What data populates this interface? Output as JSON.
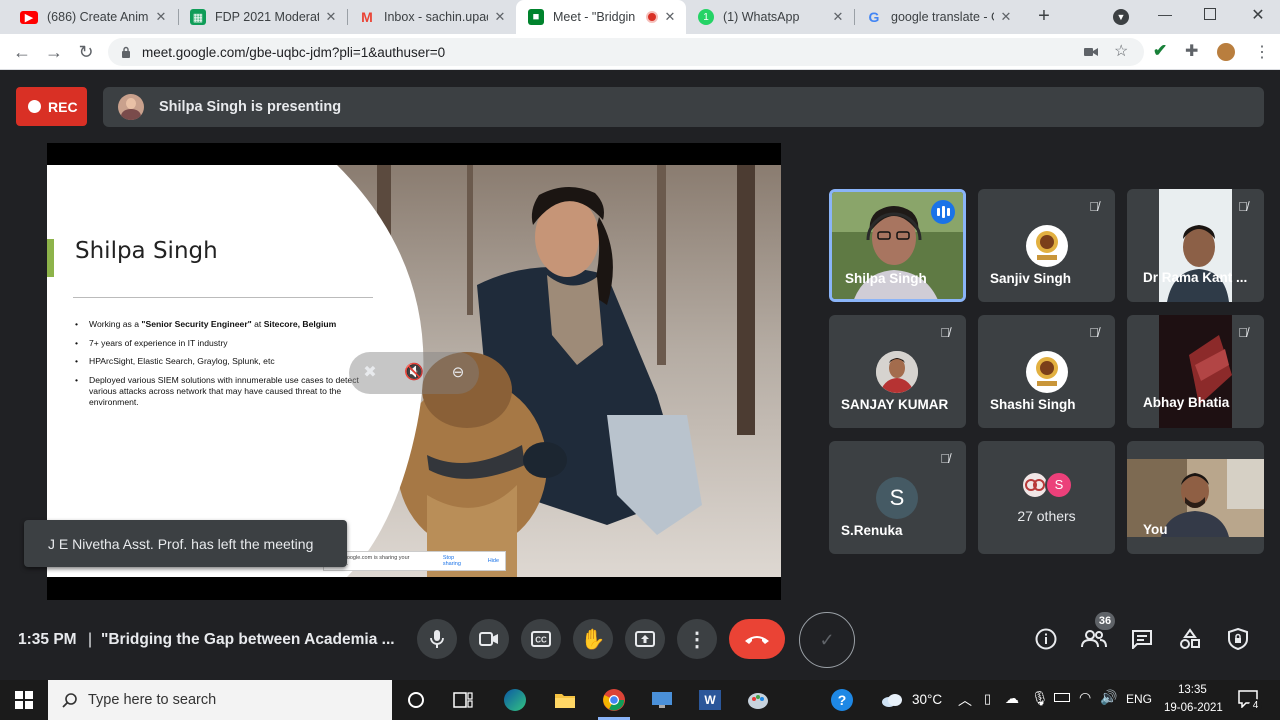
{
  "browser": {
    "tabs": [
      {
        "title": "(686) Create Animat",
        "icon": "youtube-icon",
        "color": "#ff0000",
        "active": false
      },
      {
        "title": "FDP 2021 Moderato",
        "icon": "sheets-icon",
        "color": "#0f9d58",
        "active": false
      },
      {
        "title": "Inbox - sachin.upad",
        "icon": "gmail-icon",
        "color": "#ea4335",
        "active": false
      },
      {
        "title": "Meet - \"Bridgin",
        "icon": "meet-icon",
        "color": "#00832d",
        "active": true
      },
      {
        "title": "(1) WhatsApp",
        "icon": "whatsapp-icon",
        "color": "#25d366",
        "active": false
      },
      {
        "title": "google translate - G",
        "icon": "google-icon",
        "color": "#4285f4",
        "active": false
      }
    ],
    "url": "meet.google.com/gbe-uqbc-jdm?pli=1&authuser=0"
  },
  "meet": {
    "rec_label": "REC",
    "presenting_text": "Shilpa Singh is presenting",
    "slide": {
      "name": "Shilpa Singh",
      "bullets": [
        {
          "pre": "Working as a ",
          "bold1": "\"Senior Security Engineer\"",
          "mid": " at ",
          "bold2": "Sitecore, Belgium"
        },
        {
          "pre": "7+ years of experience in IT industry"
        },
        {
          "pre": "HPArcSight, Elastic Search, Graylog, Splunk, etc"
        },
        {
          "pre": "Deployed various SIEM solutions with innumerable use cases to detect various attacks across network that may have caused threat to the environment."
        }
      ],
      "share_notice": "meet.google.com is sharing your screen.",
      "stop_sharing": "Stop sharing",
      "hide": "Hide"
    },
    "toast": "J E Nivetha Asst. Prof. has left the meeting",
    "participants": [
      {
        "name": "Shilpa Singh",
        "kind": "video"
      },
      {
        "name": "Sanjiv Singh",
        "kind": "avatar"
      },
      {
        "name": "Dr Rama Kant ...",
        "kind": "video"
      },
      {
        "name": "SANJAY KUMAR",
        "kind": "avatar"
      },
      {
        "name": "Shashi Singh",
        "kind": "avatar"
      },
      {
        "name": "Abhay Bhatia",
        "kind": "video"
      },
      {
        "name": "S.Renuka",
        "kind": "letter",
        "letter": "S"
      },
      {
        "name": "27 others",
        "kind": "others",
        "letter": "S"
      },
      {
        "name": "You",
        "kind": "video"
      }
    ],
    "time": "1:35 PM",
    "separator": "|",
    "meeting_title": "\"Bridging the Gap between Academia ...",
    "participant_count": "36"
  },
  "taskbar": {
    "search_placeholder": "Type here to search",
    "temperature": "30°C",
    "language": "ENG",
    "time": "13:35",
    "date": "19-06-2021",
    "notification_count": "4"
  },
  "colors": {
    "meet_bg": "#202124",
    "tile_bg": "#3c4043",
    "rec_red": "#d93025",
    "end_call": "#ea4335",
    "speaking_border": "#8ab4f8",
    "slide_accent": "#8db34a"
  }
}
